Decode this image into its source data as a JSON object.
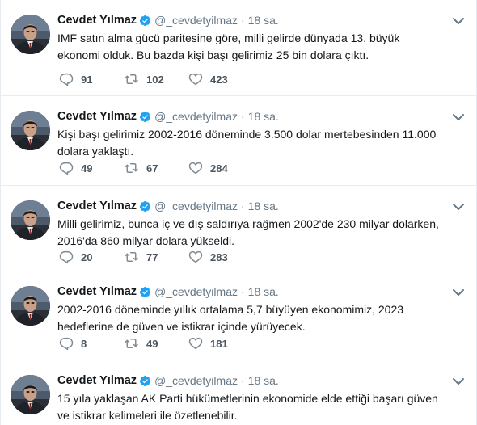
{
  "colors": {
    "icon": "#7f8b94",
    "verified": "#1da1f2",
    "text": "#14171a",
    "muted": "#657786",
    "divider": "#e6ecf0"
  },
  "tweets": [
    {
      "name": "Cevdet Yılmaz",
      "handle": "@_cevdetyilmaz",
      "separator": "·",
      "time": "18 sa.",
      "text": "IMF satın alma gücü paritesine göre, milli gelirde dünyada 13. büyük ekonomi olduk. Bu bazda kişi başı gelirimiz 25 bin dolara çıktı.",
      "replies": "91",
      "retweets": "102",
      "likes": "423"
    },
    {
      "name": "Cevdet Yılmaz",
      "handle": "@_cevdetyilmaz",
      "separator": "·",
      "time": "18 sa.",
      "text": "Kişi başı gelirimiz 2002-2016 döneminde 3.500 dolar mertebesinden 11.000 dolara yaklaştı.",
      "replies": "49",
      "retweets": "67",
      "likes": "284"
    },
    {
      "name": "Cevdet Yılmaz",
      "handle": "@_cevdetyilmaz",
      "separator": "·",
      "time": "18 sa.",
      "text": "Milli gelirimiz, bunca iç ve dış saldırıya rağmen 2002'de 230 milyar dolarken, 2016'da 860 milyar dolara yükseldi.",
      "replies": "20",
      "retweets": "77",
      "likes": "283"
    },
    {
      "name": "Cevdet Yılmaz",
      "handle": "@_cevdetyilmaz",
      "separator": "·",
      "time": "18 sa.",
      "text": "2002-2016 döneminde yıllık ortalama 5,7 büyüyen ekonomimiz, 2023 hedeflerine de güven ve istikrar içinde yürüyecek.",
      "replies": "8",
      "retweets": "49",
      "likes": "181"
    },
    {
      "name": "Cevdet Yılmaz",
      "handle": "@_cevdetyilmaz",
      "separator": "·",
      "time": "18 sa.",
      "text": "15 yıla yaklaşan AK Parti hükümetlerinin ekonomide elde ettiği başarı güven ve istikrar kelimeleri ile özetlenebilir."
    }
  ],
  "icons": {
    "verified": "verified-badge-icon",
    "caret": "chevron-down-icon",
    "reply": "reply-icon",
    "retweet": "retweet-icon",
    "like": "heart-icon",
    "avatar": "profile-photo"
  }
}
